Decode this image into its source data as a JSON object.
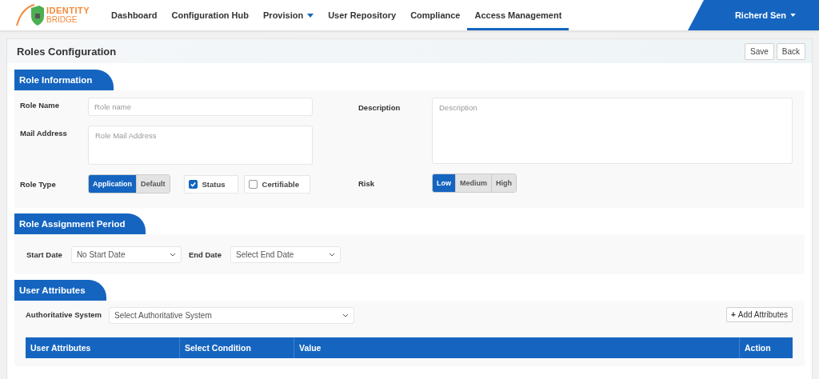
{
  "logo": {
    "line1": "IDENTITY",
    "line2": "BRIDGE"
  },
  "nav": [
    {
      "label": "Dashboard",
      "selected": false,
      "dropdown": false
    },
    {
      "label": "Configuration Hub",
      "selected": false,
      "dropdown": false
    },
    {
      "label": "Provision",
      "selected": false,
      "dropdown": true
    },
    {
      "label": "User Repository",
      "selected": false,
      "dropdown": false
    },
    {
      "label": "Compliance",
      "selected": false,
      "dropdown": false
    },
    {
      "label": "Access Management",
      "selected": true,
      "dropdown": false
    }
  ],
  "user": {
    "name": "Richerd Sen"
  },
  "page": {
    "title": "Roles Configuration",
    "buttons": [
      "Save",
      "Back"
    ]
  },
  "role_information": {
    "title": "Role Information",
    "role_name": {
      "label": "Role Name",
      "placeholder": "Role name"
    },
    "mail_address": {
      "label": "Mail Address",
      "placeholder": "Role Mail Address"
    },
    "description": {
      "label": "Description",
      "placeholder": "Description"
    },
    "role_type": {
      "label": "Role Type",
      "options": [
        {
          "label": "Application",
          "selected": true
        },
        {
          "label": "Default",
          "selected": false
        }
      ]
    },
    "checkboxes": [
      {
        "label": "Status",
        "checked": true
      },
      {
        "label": "Certifiable",
        "checked": false
      }
    ],
    "risk": {
      "label": "Risk",
      "options": [
        {
          "label": "Low",
          "selected": true
        },
        {
          "label": "Medium",
          "selected": false
        },
        {
          "label": "High",
          "selected": false
        }
      ]
    }
  },
  "role_assignment_period": {
    "title": "Role Assignment Period",
    "start_date": {
      "label": "Start Date",
      "value": "No Start Date"
    },
    "end_date": {
      "label": "End Date",
      "value": "Select End Date"
    }
  },
  "user_attributes": {
    "title": "User Attributes",
    "authoritative_system": {
      "label": "Authoritative System",
      "value": "Select Authoritative System"
    },
    "add_button": {
      "icon": "+",
      "label": "Add Attributes"
    },
    "table": {
      "columns": [
        "User Attributes",
        "Select Condition",
        "Value",
        "Action"
      ]
    }
  }
}
